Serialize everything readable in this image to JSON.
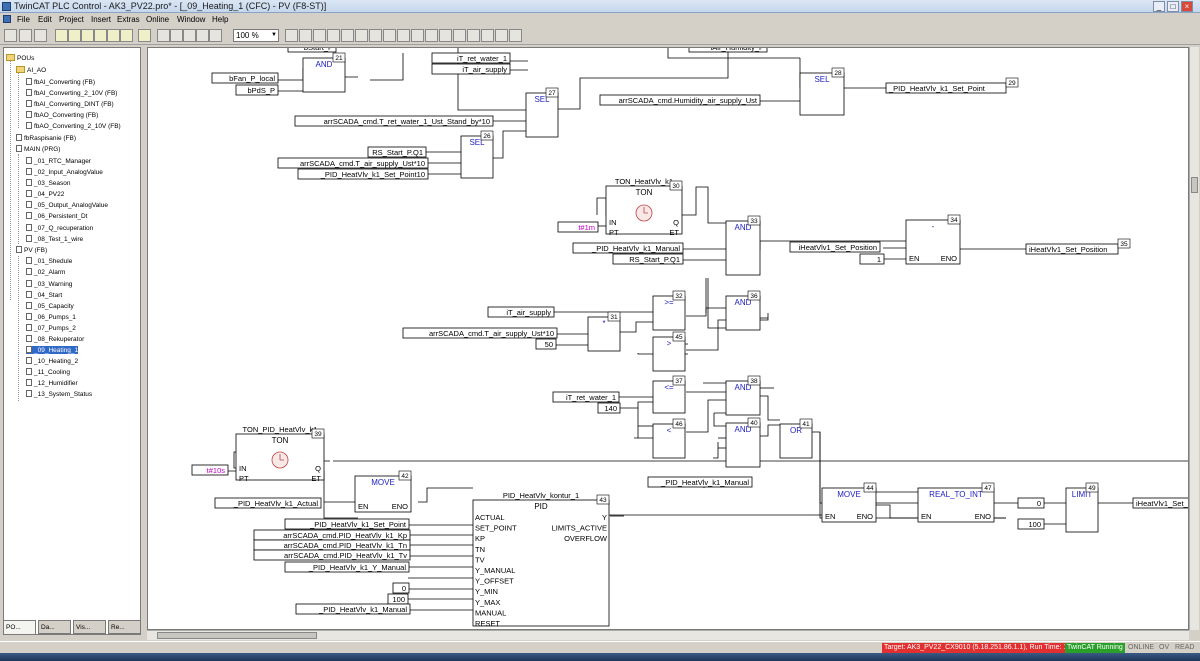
{
  "window": {
    "title": "TwinCAT PLC Control - AK3_PV22.pro* - [_09_Heating_1 (CFC) - PV (F8-ST)]"
  },
  "menu": [
    "File",
    "Edit",
    "Project",
    "Insert",
    "Extras",
    "Online",
    "Window",
    "Help"
  ],
  "toolbar": {
    "zoom": "100 %"
  },
  "tree": {
    "root": "POUs",
    "items": [
      {
        "label": "AI_AO",
        "kind": "fld",
        "level": 1
      },
      {
        "label": "fbAI_Converting (FB)",
        "kind": "doc",
        "level": 2
      },
      {
        "label": "fbAI_Converting_2_10V (FB)",
        "kind": "doc",
        "level": 2
      },
      {
        "label": "fbAI_Converting_DINT (FB)",
        "kind": "doc",
        "level": 2
      },
      {
        "label": "fbAO_Converting (FB)",
        "kind": "doc",
        "level": 2
      },
      {
        "label": "fbAO_Converting_2_10V (FB)",
        "kind": "doc",
        "level": 2
      },
      {
        "label": "fbRaspisanie (FB)",
        "kind": "doc",
        "level": 1
      },
      {
        "label": "MAIN (PRG)",
        "kind": "doc",
        "level": 1
      },
      {
        "label": "_01_RTC_Manager",
        "kind": "doc",
        "level": 2
      },
      {
        "label": "_02_Input_AnalogValue",
        "kind": "doc",
        "level": 2
      },
      {
        "label": "_03_Season",
        "kind": "doc",
        "level": 2
      },
      {
        "label": "_04_PV22",
        "kind": "doc",
        "level": 2
      },
      {
        "label": "_05_Output_AnalogValue",
        "kind": "doc",
        "level": 2
      },
      {
        "label": "_06_Persistent_Dt",
        "kind": "doc",
        "level": 2
      },
      {
        "label": "_07_Q_recuperation",
        "kind": "doc",
        "level": 2
      },
      {
        "label": "_08_Test_1_wire",
        "kind": "doc",
        "level": 2
      },
      {
        "label": "PV (FB)",
        "kind": "doc",
        "level": 1
      },
      {
        "label": "_01_Shedule",
        "kind": "doc",
        "level": 2
      },
      {
        "label": "_02_Alarm",
        "kind": "doc",
        "level": 2
      },
      {
        "label": "_03_Warning",
        "kind": "doc",
        "level": 2
      },
      {
        "label": "_04_Start",
        "kind": "doc",
        "level": 2
      },
      {
        "label": "_05_Capacity",
        "kind": "doc",
        "level": 2
      },
      {
        "label": "_06_Pumps_1",
        "kind": "doc",
        "level": 2
      },
      {
        "label": "_07_Pumps_2",
        "kind": "doc",
        "level": 2
      },
      {
        "label": "_08_Rekuperator",
        "kind": "doc",
        "level": 2
      },
      {
        "label": "_09_Heating_1",
        "kind": "doc",
        "level": 2,
        "selected": true
      },
      {
        "label": "_10_Heating_2",
        "kind": "doc",
        "level": 2
      },
      {
        "label": "_11_Cooling",
        "kind": "doc",
        "level": 2
      },
      {
        "label": "_12_Humidifier",
        "kind": "doc",
        "level": 2
      },
      {
        "label": "_13_System_Status",
        "kind": "doc",
        "level": 2
      }
    ]
  },
  "sidetabs": [
    "PO...",
    "Da...",
    "Vis...",
    "Re..."
  ],
  "status": {
    "target": "Target: AK3_PV22_CX9010 (5.18.251.86.1.1), Run Time: 1",
    "running": "TwinCAT Running",
    "indicators": [
      "ONLINE",
      "OV",
      "READ"
    ]
  },
  "cfc": {
    "inputs": [
      {
        "id": "in1",
        "text": "bStart_P"
      },
      {
        "id": "in2",
        "text": "bFan_P_local"
      },
      {
        "id": "in3",
        "text": "bPdS_P"
      },
      {
        "id": "in4",
        "text": "iT_ret_water_1"
      },
      {
        "id": "in5",
        "text": "iT_air_supply"
      },
      {
        "id": "in6",
        "text": "iAir_Humidity_P"
      },
      {
        "id": "in7",
        "text": "arrSCADA_cmd.Humidity_air_supply_Ust"
      },
      {
        "id": "in8",
        "text": "arrSCADA_cmd.T_ret_water_1_Ust_Stand_by*10"
      },
      {
        "id": "in9",
        "text": "RS_Start_P.Q1"
      },
      {
        "id": "in10",
        "text": "arrSCADA_cmd.T_air_supply_Ust*10"
      },
      {
        "id": "in11",
        "text": "_PID_HeatVlv_k1_Set_Point10"
      },
      {
        "id": "in12",
        "text": "t#1m"
      },
      {
        "id": "in13",
        "text": "_PID_HeatVlv_k1_Manual"
      },
      {
        "id": "in14",
        "text": "RS_Start_P.Q1"
      },
      {
        "id": "in15",
        "text": "iHeatVlv1_Set_Position"
      },
      {
        "id": "in16",
        "text": "1"
      },
      {
        "id": "in17",
        "text": "iT_air_supply"
      },
      {
        "id": "in18",
        "text": "arrSCADA_cmd.T_air_supply_Ust*10"
      },
      {
        "id": "in19",
        "text": "50"
      },
      {
        "id": "in20",
        "text": "iT_ret_water_1"
      },
      {
        "id": "in21",
        "text": "140"
      },
      {
        "id": "in22",
        "text": "t#10s"
      },
      {
        "id": "in23",
        "text": "_PID_HeatVlv_k1_Actual"
      },
      {
        "id": "in24",
        "text": "_PID_HeatVlv_k1_Set_Point"
      },
      {
        "id": "in25",
        "text": "arrSCADA_cmd.PID_HeatVlv_k1_Kp"
      },
      {
        "id": "in26",
        "text": "arrSCADA_cmd.PID_HeatVlv_k1_Tn"
      },
      {
        "id": "in27",
        "text": "arrSCADA_cmd.PID_HeatVlv_k1_Tv"
      },
      {
        "id": "in28",
        "text": "_PID_HeatVlv_k1_Y_Manual"
      },
      {
        "id": "in29",
        "text": "0"
      },
      {
        "id": "in30",
        "text": "100"
      },
      {
        "id": "in31",
        "text": "_PID_HeatVlv_k1_Manual"
      },
      {
        "id": "in32",
        "text": "_PID_HeatVlv_k1_Manual"
      },
      {
        "id": "in33",
        "text": "0"
      },
      {
        "id": "in34",
        "text": "100"
      }
    ],
    "outputs": [
      {
        "id": "out1",
        "text": "_PID_HeatVlv_k1_Set_Point",
        "num": "29"
      },
      {
        "id": "out2",
        "text": "iHeatVlv1_Set_Position",
        "num": "35"
      },
      {
        "id": "out3",
        "text": "iHeatVlv1_Set_..."
      }
    ],
    "blocks": [
      {
        "id": "b21",
        "op": "AND",
        "num": "21"
      },
      {
        "id": "b27",
        "op": "SEL",
        "num": "27"
      },
      {
        "id": "b28",
        "op": "SEL",
        "num": "28"
      },
      {
        "id": "b26",
        "op": "SEL",
        "num": "26"
      },
      {
        "id": "b30",
        "op": "TON",
        "inst": "TON_HeatVlv_k1",
        "num": "30",
        "pins": [
          "IN",
          "PT",
          "Q",
          "ET"
        ]
      },
      {
        "id": "b33",
        "op": "AND",
        "num": "33"
      },
      {
        "id": "b34",
        "op": "-",
        "num": "34",
        "pins": [
          "EN",
          "ENO"
        ]
      },
      {
        "id": "b31",
        "op": "*",
        "num": "31"
      },
      {
        "id": "b32",
        "op": ">=",
        "num": "32"
      },
      {
        "id": "b36",
        "op": "AND",
        "num": "36"
      },
      {
        "id": "b45",
        "op": ">",
        "num": "45"
      },
      {
        "id": "b37",
        "op": "<=",
        "num": "37"
      },
      {
        "id": "b38",
        "op": "AND",
        "num": "38"
      },
      {
        "id": "b46",
        "op": "<",
        "num": "46"
      },
      {
        "id": "b40",
        "op": "AND",
        "num": "40"
      },
      {
        "id": "b41",
        "op": "OR",
        "num": "41"
      },
      {
        "id": "b39",
        "op": "TON",
        "inst": "TON_PID_HeatVlv_k1",
        "num": "39",
        "pins": [
          "IN",
          "PT",
          "Q",
          "ET"
        ]
      },
      {
        "id": "b42",
        "op": "MOVE",
        "num": "42",
        "pins": [
          "EN",
          "ENO"
        ]
      },
      {
        "id": "b43",
        "op": "PID",
        "inst": "PID_HeatVlv_kontur_1",
        "num": "43",
        "pins_in": [
          "ACTUAL",
          "SET_POINT",
          "KP",
          "TN",
          "TV",
          "Y_MANUAL",
          "Y_OFFSET",
          "Y_MIN",
          "Y_MAX",
          "MANUAL",
          "RESET"
        ],
        "pins_out": [
          "Y",
          "LIMITS_ACTIVE",
          "OVERFLOW"
        ]
      },
      {
        "id": "b44",
        "op": "MOVE",
        "num": "44",
        "pins": [
          "EN",
          "ENO"
        ]
      },
      {
        "id": "b47",
        "op": "REAL_TO_INT",
        "num": "47",
        "pins": [
          "EN",
          "ENO"
        ]
      },
      {
        "id": "b49",
        "op": "LIMIT",
        "num": "49"
      }
    ]
  }
}
